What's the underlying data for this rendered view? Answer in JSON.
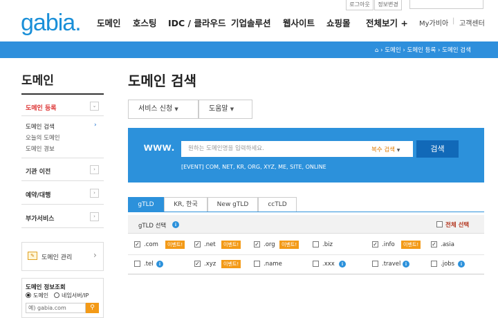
{
  "header": {
    "logo": "gabia.",
    "gnb": [
      "도메인",
      "호스팅",
      "IDC / 클라우드",
      "기업솔루션",
      "웹사이트",
      "쇼핑몰",
      "전체보기 +"
    ],
    "top_buttons": [
      "로그아웃",
      "정보변경"
    ],
    "my_gabia": "My가비아",
    "customer_center": "고객센터"
  },
  "breadcrumb": [
    "도메인",
    "도메인 등록",
    "도메인 검색"
  ],
  "sidebar": {
    "title": "도메인",
    "sections": [
      {
        "label": "도메인 등록",
        "active": true
      },
      {
        "label": "기관 이전"
      },
      {
        "label": "예약/대행"
      },
      {
        "label": "부가서비스"
      }
    ],
    "sub_items": [
      "도메인 검색",
      "오늘의 도메인",
      "도메인 경보"
    ],
    "manage": "도메인 관리",
    "whois": {
      "title": "도메인 정보조회",
      "radio1": "도메인",
      "radio2": "네임서버/IP",
      "placeholder": "예) gabia.com"
    }
  },
  "main": {
    "title": "도메인 검색",
    "btn_service": "서비스 신청",
    "btn_help": "도움말",
    "www": "www.",
    "search_placeholder": "원하는 도메인명을 입력하세요.",
    "multi_search": "복수 검색",
    "search_button": "검색",
    "event": "[EVENT]  COM, NET, KR, ORG, XYZ, ME, SITE, ONLINE",
    "tabs": [
      "gTLD",
      "KR, 한국",
      "New gTLD",
      "ccTLD"
    ],
    "tld_select_label": "gTLD 선택",
    "select_all": "전체 선택",
    "badge_text": "이벤트!",
    "tlds_row1": [
      ".com",
      ".net",
      ".org",
      ".biz",
      ".info",
      ".asia"
    ],
    "tlds_row2": [
      ".tel",
      ".xyz",
      ".name",
      ".xxx",
      ".travel",
      ".jobs"
    ]
  },
  "colors": {
    "accent": "#2c91db",
    "badge": "#f39a17",
    "search_button": "#1169b8"
  }
}
